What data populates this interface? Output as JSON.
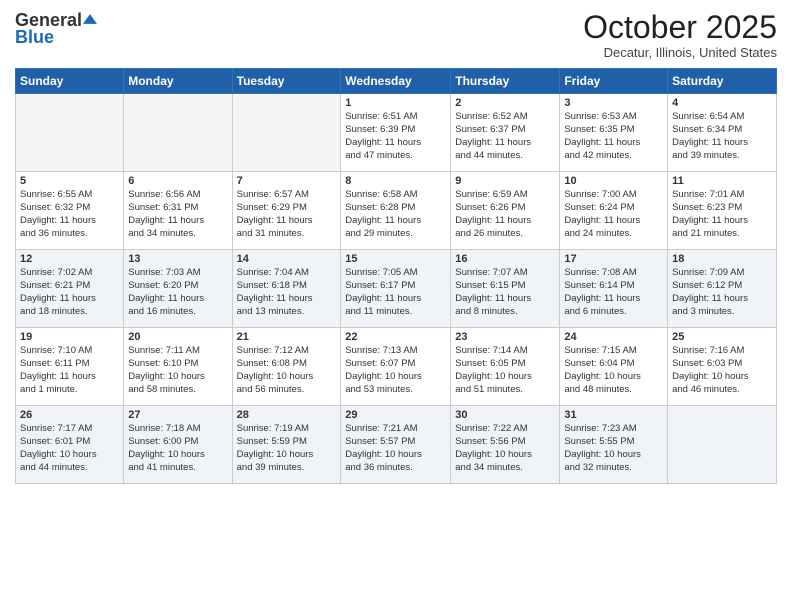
{
  "logo": {
    "general": "General",
    "blue": "Blue"
  },
  "title": "October 2025",
  "location": "Decatur, Illinois, United States",
  "days_header": [
    "Sunday",
    "Monday",
    "Tuesday",
    "Wednesday",
    "Thursday",
    "Friday",
    "Saturday"
  ],
  "weeks": [
    [
      {
        "day": "",
        "info": ""
      },
      {
        "day": "",
        "info": ""
      },
      {
        "day": "",
        "info": ""
      },
      {
        "day": "1",
        "info": "Sunrise: 6:51 AM\nSunset: 6:39 PM\nDaylight: 11 hours\nand 47 minutes."
      },
      {
        "day": "2",
        "info": "Sunrise: 6:52 AM\nSunset: 6:37 PM\nDaylight: 11 hours\nand 44 minutes."
      },
      {
        "day": "3",
        "info": "Sunrise: 6:53 AM\nSunset: 6:35 PM\nDaylight: 11 hours\nand 42 minutes."
      },
      {
        "day": "4",
        "info": "Sunrise: 6:54 AM\nSunset: 6:34 PM\nDaylight: 11 hours\nand 39 minutes."
      }
    ],
    [
      {
        "day": "5",
        "info": "Sunrise: 6:55 AM\nSunset: 6:32 PM\nDaylight: 11 hours\nand 36 minutes."
      },
      {
        "day": "6",
        "info": "Sunrise: 6:56 AM\nSunset: 6:31 PM\nDaylight: 11 hours\nand 34 minutes."
      },
      {
        "day": "7",
        "info": "Sunrise: 6:57 AM\nSunset: 6:29 PM\nDaylight: 11 hours\nand 31 minutes."
      },
      {
        "day": "8",
        "info": "Sunrise: 6:58 AM\nSunset: 6:28 PM\nDaylight: 11 hours\nand 29 minutes."
      },
      {
        "day": "9",
        "info": "Sunrise: 6:59 AM\nSunset: 6:26 PM\nDaylight: 11 hours\nand 26 minutes."
      },
      {
        "day": "10",
        "info": "Sunrise: 7:00 AM\nSunset: 6:24 PM\nDaylight: 11 hours\nand 24 minutes."
      },
      {
        "day": "11",
        "info": "Sunrise: 7:01 AM\nSunset: 6:23 PM\nDaylight: 11 hours\nand 21 minutes."
      }
    ],
    [
      {
        "day": "12",
        "info": "Sunrise: 7:02 AM\nSunset: 6:21 PM\nDaylight: 11 hours\nand 18 minutes."
      },
      {
        "day": "13",
        "info": "Sunrise: 7:03 AM\nSunset: 6:20 PM\nDaylight: 11 hours\nand 16 minutes."
      },
      {
        "day": "14",
        "info": "Sunrise: 7:04 AM\nSunset: 6:18 PM\nDaylight: 11 hours\nand 13 minutes."
      },
      {
        "day": "15",
        "info": "Sunrise: 7:05 AM\nSunset: 6:17 PM\nDaylight: 11 hours\nand 11 minutes."
      },
      {
        "day": "16",
        "info": "Sunrise: 7:07 AM\nSunset: 6:15 PM\nDaylight: 11 hours\nand 8 minutes."
      },
      {
        "day": "17",
        "info": "Sunrise: 7:08 AM\nSunset: 6:14 PM\nDaylight: 11 hours\nand 6 minutes."
      },
      {
        "day": "18",
        "info": "Sunrise: 7:09 AM\nSunset: 6:12 PM\nDaylight: 11 hours\nand 3 minutes."
      }
    ],
    [
      {
        "day": "19",
        "info": "Sunrise: 7:10 AM\nSunset: 6:11 PM\nDaylight: 11 hours\nand 1 minute."
      },
      {
        "day": "20",
        "info": "Sunrise: 7:11 AM\nSunset: 6:10 PM\nDaylight: 10 hours\nand 58 minutes."
      },
      {
        "day": "21",
        "info": "Sunrise: 7:12 AM\nSunset: 6:08 PM\nDaylight: 10 hours\nand 56 minutes."
      },
      {
        "day": "22",
        "info": "Sunrise: 7:13 AM\nSunset: 6:07 PM\nDaylight: 10 hours\nand 53 minutes."
      },
      {
        "day": "23",
        "info": "Sunrise: 7:14 AM\nSunset: 6:05 PM\nDaylight: 10 hours\nand 51 minutes."
      },
      {
        "day": "24",
        "info": "Sunrise: 7:15 AM\nSunset: 6:04 PM\nDaylight: 10 hours\nand 48 minutes."
      },
      {
        "day": "25",
        "info": "Sunrise: 7:16 AM\nSunset: 6:03 PM\nDaylight: 10 hours\nand 46 minutes."
      }
    ],
    [
      {
        "day": "26",
        "info": "Sunrise: 7:17 AM\nSunset: 6:01 PM\nDaylight: 10 hours\nand 44 minutes."
      },
      {
        "day": "27",
        "info": "Sunrise: 7:18 AM\nSunset: 6:00 PM\nDaylight: 10 hours\nand 41 minutes."
      },
      {
        "day": "28",
        "info": "Sunrise: 7:19 AM\nSunset: 5:59 PM\nDaylight: 10 hours\nand 39 minutes."
      },
      {
        "day": "29",
        "info": "Sunrise: 7:21 AM\nSunset: 5:57 PM\nDaylight: 10 hours\nand 36 minutes."
      },
      {
        "day": "30",
        "info": "Sunrise: 7:22 AM\nSunset: 5:56 PM\nDaylight: 10 hours\nand 34 minutes."
      },
      {
        "day": "31",
        "info": "Sunrise: 7:23 AM\nSunset: 5:55 PM\nDaylight: 10 hours\nand 32 minutes."
      },
      {
        "day": "",
        "info": ""
      }
    ]
  ]
}
